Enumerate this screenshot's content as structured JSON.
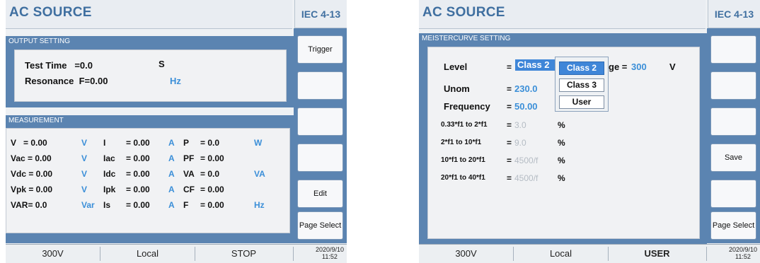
{
  "left": {
    "title": "AC SOURCE",
    "iec": "IEC 4-13",
    "output_section": "OUTPUT SETTING",
    "test_time_label": "Test Time   =0.0",
    "test_time_unit": "S",
    "resonance_label": "Resonance  F=0.00",
    "resonance_unit": "Hz",
    "measurement_section": "MEASUREMENT",
    "meas": [
      [
        "V   = 0.00",
        "V",
        "I",
        "= 0.00",
        "A",
        "P",
        "= 0.0",
        "W"
      ],
      [
        "Vac = 0.00",
        "V",
        "Iac",
        "= 0.00",
        "A",
        "PF",
        "= 0.00",
        ""
      ],
      [
        "Vdc = 0.00",
        "V",
        "Idc",
        "= 0.00",
        "A",
        "VA",
        "= 0.0",
        "VA"
      ],
      [
        "Vpk = 0.00",
        "V",
        "Ipk",
        "= 0.00",
        "A",
        "CF",
        "= 0.00",
        ""
      ],
      [
        "VAR= 0.0",
        "Var",
        "Is",
        "= 0.00",
        "A",
        "F",
        "= 0.00",
        "Hz"
      ]
    ],
    "buttons": [
      "Trigger",
      "",
      "",
      "",
      "Edit",
      "Page Select"
    ],
    "footer": {
      "voltage": "300V",
      "mode": "Local",
      "status": "STOP",
      "date": "2020/9/10",
      "time": "11:52"
    }
  },
  "right": {
    "title": "AC SOURCE",
    "iec": "IEC 4-13",
    "section": "MEISTERCURVE SETTING",
    "level_label": "Level",
    "level_eq": "=",
    "level_value": "Class 2",
    "voltage_tail": "ge = ",
    "voltage_value": "300",
    "voltage_unit": "V",
    "unom_label": "Unom",
    "unom_eq": "=",
    "unom_value": "230.0",
    "freq_label": "Frequency",
    "freq_eq": "=",
    "freq_value": "50.00",
    "ranges": [
      {
        "label": "0.33*f1 to 2*f1",
        "eq": "=",
        "value": "3.0",
        "unit": "%"
      },
      {
        "label": "2*f1 to 10*f1",
        "eq": "=",
        "value": "9.0",
        "unit": "%"
      },
      {
        "label": "10*f1 to 20*f1",
        "eq": "=",
        "value": "4500/f",
        "unit": "%"
      },
      {
        "label": "20*f1 to 40*f1",
        "eq": "=",
        "value": "4500/f",
        "unit": "%"
      }
    ],
    "dropdown": [
      "Class 2",
      "Class 3",
      "User"
    ],
    "buttons": [
      "",
      "",
      "",
      "Save",
      "",
      "Page Select"
    ],
    "footer": {
      "voltage": "300V",
      "mode": "Local",
      "status": "USER",
      "date": "2020/9/10",
      "time": "11:52"
    }
  }
}
